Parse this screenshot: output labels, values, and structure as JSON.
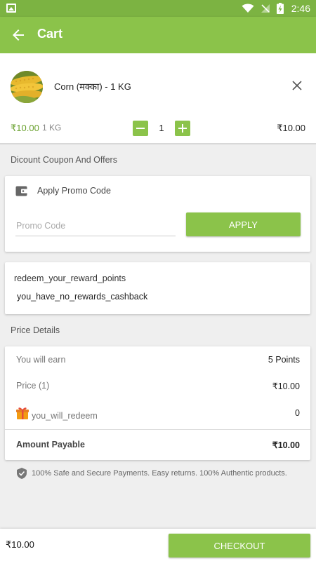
{
  "status_bar": {
    "time": "2:46",
    "icons": [
      "image-icon",
      "wifi-icon",
      "no-signal-icon",
      "battery-charging-icon"
    ]
  },
  "toolbar": {
    "title": "Cart",
    "back_icon": "arrow-back-icon"
  },
  "cart_item": {
    "name": "Corn (मक्का) - 1 KG",
    "price": "₹10.00",
    "unit": "1 KG",
    "quantity": "1",
    "total": "₹10.00",
    "image_icon": "corn-image"
  },
  "offers": {
    "section_title": "Dicount Coupon And Offers",
    "promo_title": "Apply Promo Code",
    "promo_placeholder": "Promo Code",
    "promo_value": "",
    "apply_label": "APPLY"
  },
  "rewards": {
    "title": "redeem_your_reward_points",
    "message": "you_have_no_rewards_cashback"
  },
  "price_details": {
    "section_title": "Price Details",
    "rows": [
      {
        "label": "You will earn",
        "value": "5 Points"
      },
      {
        "label": "Price (1)",
        "value": "₹10.00"
      },
      {
        "label": "you_will_redeem",
        "value": "0"
      }
    ],
    "total_label": "Amount Payable",
    "total_value": "₹10.00"
  },
  "secure_note": "100% Safe and Secure Payments. Easy returns. 100% Authentic products.",
  "bottom_bar": {
    "amount": "₹10.00",
    "checkout_label": "CHECKOUT"
  },
  "colors": {
    "primary": "#8bc34a",
    "status_bar": "#7cb342",
    "price_green": "#6aa12f"
  }
}
